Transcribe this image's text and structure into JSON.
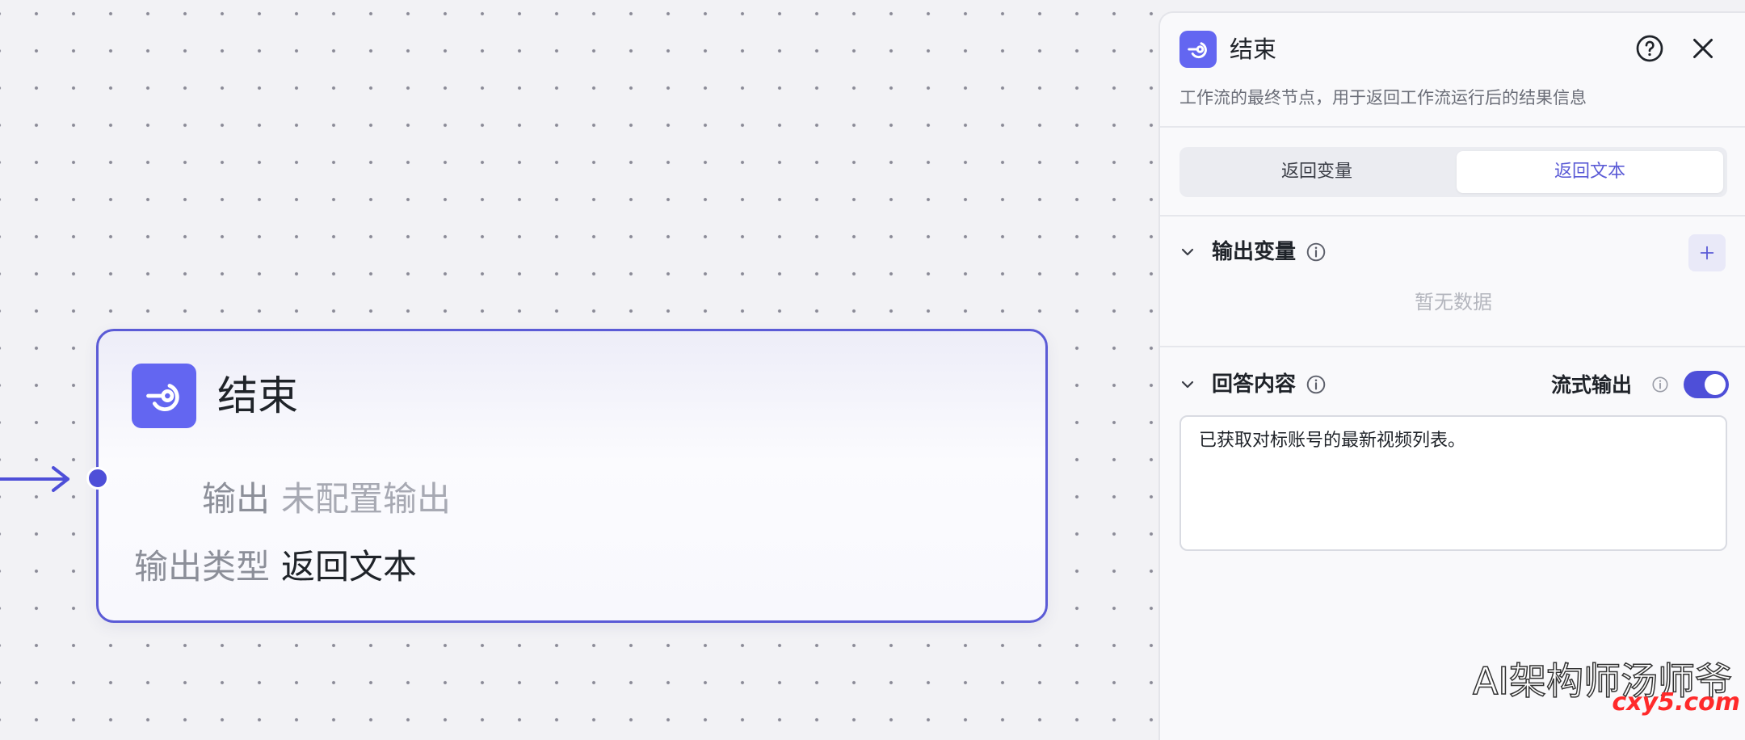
{
  "canvas": {
    "node": {
      "title": "结束",
      "icon": "end-node-icon",
      "output_label": "输出",
      "output_value": "未配置输出",
      "output_type_label": "输出类型",
      "output_type_value": "返回文本"
    }
  },
  "panel": {
    "title": "结束",
    "icon": "end-node-icon",
    "description": "工作流的最终节点，用于返回工作流运行后的结果信息",
    "tabs": [
      {
        "label": "返回变量",
        "active": false
      },
      {
        "label": "返回文本",
        "active": true
      }
    ],
    "output_vars": {
      "title": "输出变量",
      "empty_text": "暂无数据"
    },
    "answer": {
      "title": "回答内容",
      "stream_label": "流式输出",
      "stream_enabled": true,
      "content": "已获取对标账号的最新视频列表。"
    }
  },
  "watermark": {
    "line1": "AI架构师汤师爷",
    "line2": "cxy5.com"
  },
  "colors": {
    "accent": "#5b5bd6",
    "icon_bg": "#6366f1",
    "toggle_on": "#4e4fd8"
  }
}
